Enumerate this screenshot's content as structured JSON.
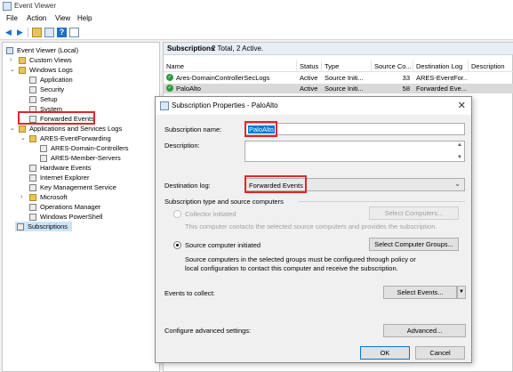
{
  "window": {
    "title": "Event Viewer"
  },
  "menu": [
    "File",
    "Action",
    "View",
    "Help"
  ],
  "toolbar": [
    "back-icon",
    "forward-icon",
    "folder-icon",
    "properties-icon",
    "help-icon",
    "panel-icon"
  ],
  "tree": {
    "root": "Event Viewer (Local)",
    "custom_views": "Custom Views",
    "windows_logs": "Windows Logs",
    "application": "Application",
    "security": "Security",
    "setup": "Setup",
    "system": "System",
    "forwarded_events": "Forwarded Events",
    "app_services": "Applications and Services Logs",
    "ares_fwd": "ARES-EventForwarding",
    "ares_dc": "ARES-Domain-Controllers",
    "ares_member": "ARES-Member-Servers",
    "hardware": "Hardware Events",
    "ie": "Internet Explorer",
    "kms": "Key Management Service",
    "microsoft": "Microsoft",
    "ops_manager": "Operations Manager",
    "powershell": "Windows PowerShell",
    "subscriptions": "Subscriptions"
  },
  "right_pane": {
    "title": "Subscriptions",
    "count": "2 Total, 2 Active.",
    "columns": [
      "Name",
      "Status",
      "Type",
      "Source Co...",
      "Destination Log",
      "Description"
    ],
    "rows": [
      [
        "Ares-DomainControllerSecLogs",
        "Active",
        "Source Initi...",
        "33",
        "ARES-EventFor...",
        ""
      ],
      [
        "PaloAlto",
        "Active",
        "Source Initi...",
        "58",
        "Forwarded Eve...",
        ""
      ]
    ]
  },
  "dialog": {
    "title": "Subscription Properties - PaloAlto",
    "name_label": "Subscription name:",
    "name_value": "PaloAlto",
    "description_label": "Description:",
    "description_value": "",
    "dest_label": "Destination log:",
    "dest_value": "Forwarded Events",
    "type_group": "Subscription type and source computers",
    "collector_label": "Collector initiated",
    "collector_desc": "This computer contacts the selected source computers and provides the subscription.",
    "select_computers": "Select Computers...",
    "source_label": "Source computer initiated",
    "source_desc_1": "Source computers in the selected groups must be configured through policy or",
    "source_desc_2": "local configuration to contact this computer and receive the subscription.",
    "select_groups": "Select Computer Groups...",
    "events_label": "Events to collect:",
    "select_events": "Select Events...",
    "advanced_label": "Configure advanced settings:",
    "advanced_btn": "Advanced...",
    "ok": "OK",
    "cancel": "Cancel"
  },
  "colors": {
    "highlight": "#e0262a",
    "selection": "#cce4f7",
    "active_check": "#2e9a3e"
  }
}
